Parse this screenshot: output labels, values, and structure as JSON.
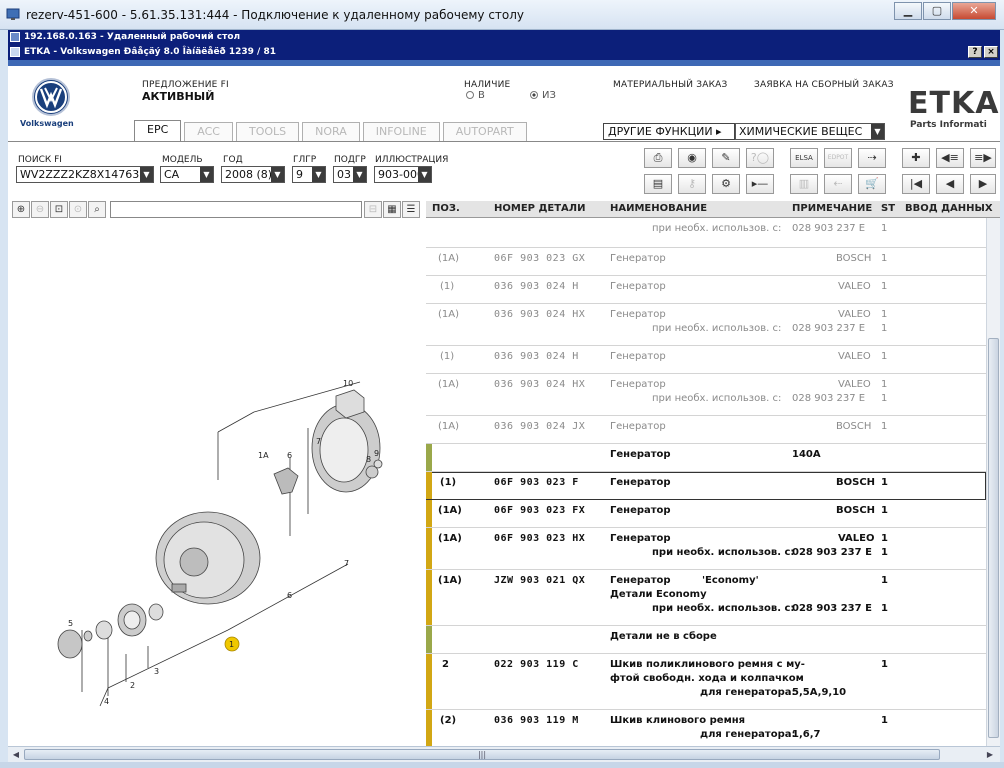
{
  "outer_window": {
    "title": "rezerv-451-600 - 5.61.35.131:444 - Подключение к удаленному рабочему столу"
  },
  "rdp_window": {
    "title": "192.168.0.163 - Удаленный рабочий стол"
  },
  "etka_window": {
    "title": "ETKA - Volkswagen Ðâåçäý 8.0 Îàíäëåëð 1239 / 81",
    "help_btn": "?",
    "close_btn": "×"
  },
  "brand": {
    "name": "Volkswagen",
    "color": "#1a3f7c"
  },
  "header": {
    "offer_label": "ПРЕДЛОЖЕНИЕ FI",
    "offer_value": "АКТИВНЫЙ",
    "availability_label": "НАЛИЧИЕ",
    "radio_v": "В",
    "radio_iz": "ИЗ",
    "material_order": "МАТЕРИАЛЬНЫЙ ЗАКАЗ",
    "assembly_order": "ЗАЯВКА НА СБОРНЫЙ ЗАКАЗ",
    "etka_logo": "ETKA",
    "etka_sub": "Parts Informati"
  },
  "tabs": [
    {
      "label": "EPC",
      "active": true
    },
    {
      "label": "ACC",
      "active": false
    },
    {
      "label": "TOOLS",
      "active": false
    },
    {
      "label": "NORA",
      "active": false
    },
    {
      "label": "INFOLINE",
      "active": false
    },
    {
      "label": "AUTOPART",
      "active": false
    }
  ],
  "functions": {
    "other_label": "ДРУГИЕ ФУНКЦИИ ▸",
    "chem_value": "ХИМИЧЕСКИЕ ВЕЩЕС"
  },
  "filters": {
    "search_fi_label": "ПОИСК FI",
    "search_fi_value": "WV2ZZZ2KZ8X147637",
    "model_label": "МОДЕЛЬ",
    "model_value": "CA",
    "year_label": "ГОД",
    "year_value": "2008 (8)",
    "glgr_label": "ГЛГР",
    "glgr_value": "9",
    "podgr_label": "ПОДГР",
    "podgr_value": "03",
    "illust_label": "ИЛЛЮСТРАЦИЯ",
    "illust_value": "903-000"
  },
  "toolbar": {
    "icons_row1": [
      "printer-icon",
      "cd-icon",
      "tools-icon",
      "help-balloon-icon",
      "elsa-icon",
      "edpot-icon",
      "cart-forward-icon",
      "pin-icon",
      "list-prev-icon",
      "list-next-icon"
    ],
    "icons_row2": [
      "catalog-icon",
      "key-icon",
      "bike-icon",
      "collapse-icon",
      "split-icon",
      "cart-back-icon",
      "cart-icon",
      "first-page-icon",
      "prev-page-icon",
      "next-page-icon"
    ],
    "elsa_label": "ELSA",
    "edpot_label": "EDPOT"
  },
  "table": {
    "headers": {
      "pos": "ПОЗ.",
      "part": "НОМЕР ДЕТАЛИ",
      "name": "НАИМЕНОВАНИЕ",
      "note": "ПРИМЕЧАНИЕ",
      "st": "ST",
      "input": "ВВОД ДАННЫХ"
    },
    "rows": [
      {
        "pos": "",
        "part": "",
        "name": "",
        "sub": "при необх. использов. с:",
        "note": "028 903 237 E",
        "st": "1",
        "style": "grey",
        "bar": ""
      },
      {
        "pos": "(1A)",
        "part": "06F 903 023 GX",
        "name": "Генератор",
        "sub": "",
        "note": "BOSCH",
        "st": "1",
        "style": "grey",
        "bar": ""
      },
      {
        "pos": "(1)",
        "part": "036 903 024 H",
        "name": "Генератор",
        "sub": "",
        "note": "VALEO",
        "st": "1",
        "style": "grey",
        "bar": ""
      },
      {
        "pos": "(1A)",
        "part": "036 903 024 HX",
        "name": "Генератор",
        "sub": "при необх. использов. с:",
        "note": "VALEO",
        "note2": "028 903 237 E",
        "st": "1",
        "st2": "1",
        "style": "grey",
        "bar": ""
      },
      {
        "pos": "(1)",
        "part": "036 903 024 H",
        "name": "Генератор",
        "sub": "",
        "note": "VALEO",
        "st": "1",
        "style": "grey",
        "bar": ""
      },
      {
        "pos": "(1A)",
        "part": "036 903 024 HX",
        "name": "Генератор",
        "sub": "при необх. использов. с:",
        "note": "VALEO",
        "note2": "028 903 237 E",
        "st": "1",
        "st2": "1",
        "style": "grey",
        "bar": ""
      },
      {
        "pos": "(1A)",
        "part": "036 903 024 JX",
        "name": "Генератор",
        "sub": "",
        "note": "BOSCH",
        "st": "1",
        "style": "grey",
        "bar": ""
      },
      {
        "pos": "",
        "part": "",
        "name": "Генератор",
        "sub": "",
        "note": "140A",
        "st": "",
        "style": "blk",
        "bar": "#9aa84a"
      },
      {
        "pos": "(1)",
        "part": "06F 903 023 F",
        "name": "Генератор",
        "sub": "",
        "note": "BOSCH",
        "st": "1",
        "style": "blk",
        "bar": "#d2a714"
      },
      {
        "pos": "(1A)",
        "part": "06F 903 023 FX",
        "name": "Генератор",
        "sub": "",
        "note": "BOSCH",
        "st": "1",
        "style": "blk",
        "bar": "#d2a714"
      },
      {
        "pos": "(1A)",
        "part": "06F 903 023 HX",
        "name": "Генератор",
        "sub": "при необх. использов. с:",
        "note": "VALEO",
        "note2": "028 903 237 E",
        "st": "1",
        "st2": "1",
        "style": "blk",
        "bar": "#d2a714"
      },
      {
        "pos": "(1A)",
        "part": "JZW 903 021 QX",
        "name": "Генератор",
        "name_extra": "'Economy'",
        "name2": "Детали Economy",
        "sub": "при необх. использов. с:",
        "note": "",
        "note2": "028 903 237 E",
        "st": "1",
        "st2": "1",
        "style": "blk",
        "bar": "#d2a714"
      },
      {
        "pos": "",
        "part": "",
        "name": "Детали не в сборе",
        "sub": "",
        "note": "",
        "st": "",
        "style": "blk",
        "bar": "#9aa84a"
      },
      {
        "pos": "2",
        "part": "022 903 119 C",
        "name": "Шкив поликлинового ремня с му-",
        "name2": "фтой свободн. хода и колпачком",
        "sub": "для генератора:",
        "note": "",
        "note2": "5,5A,9,10",
        "st": "1",
        "style": "blk",
        "bar": "#d2a714"
      },
      {
        "pos": "(2)",
        "part": "036 903 119 M",
        "name": "Шкив клинового ремня",
        "sub": "для генератора:",
        "note": "",
        "note2": "1,6,7",
        "st": "1",
        "style": "blk",
        "bar": "#d2a714"
      }
    ]
  },
  "illustration": {
    "callouts": [
      "10",
      "1A",
      "7",
      "6",
      "8",
      "9",
      "5",
      "4",
      "2",
      "3",
      "1",
      "6",
      "7"
    ]
  }
}
